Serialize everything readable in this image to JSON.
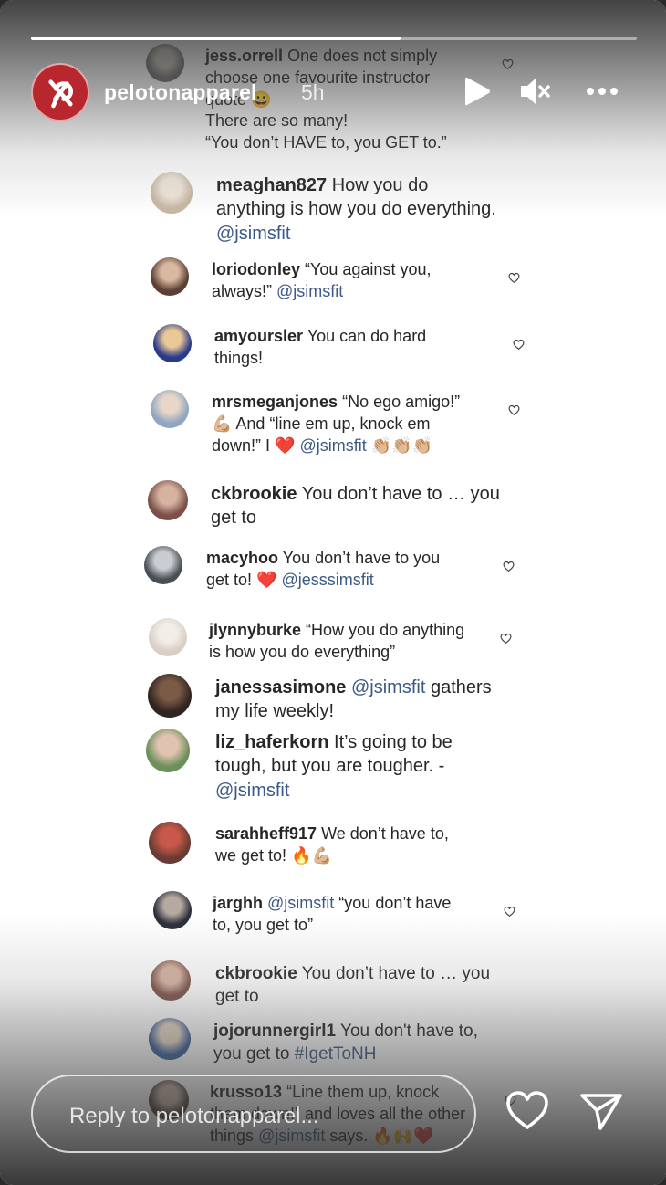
{
  "story": {
    "username": "pelotonapparel",
    "time_ago": "5h",
    "progress": 0.61,
    "reply_placeholder": "Reply to pelotonapparel..."
  },
  "comments": [
    {
      "user": "jess.orrell",
      "lines": [
        "One does not simply",
        "choose one favourite instructor",
        "quote 😀",
        "There are so many!",
        "“You don’t HAVE to, you GET to.”"
      ]
    },
    {
      "user": "meaghan827",
      "lines": [
        "How you do",
        "anything is how you do everything."
      ],
      "mention": "@jsimsfit"
    },
    {
      "user": "loriodonley",
      "lines": [
        "“You against you,",
        "always!”"
      ],
      "mention": "@jsimsfit"
    },
    {
      "user": "amyoursler",
      "lines": [
        "You can do hard",
        "things!"
      ]
    },
    {
      "user": "mrsmeganjones",
      "lines": [
        "“No ego amigo!”",
        "💪🏼 And “line em up, knock em",
        "down!” I ❤️"
      ],
      "mention": "@jsimsfit",
      "suffix": " 👏🏼👏🏼👏🏼"
    },
    {
      "user": "ckbrookie",
      "lines": [
        "You don’t have to … you",
        "get to"
      ]
    },
    {
      "user": "macyhoo",
      "lines": [
        "You don’t have to you",
        "get to! ❤️"
      ],
      "mention": "@jesssimsfit"
    },
    {
      "user": "jlynnyburke",
      "lines": [
        "“How you do anything",
        "is how you do everything”"
      ]
    },
    {
      "user": "janessasimone",
      "lines": [
        "",
        "my life weekly!"
      ],
      "mention_first": "@jsimsfit",
      "first_tail": " gathers"
    },
    {
      "user": "liz_haferkorn",
      "lines": [
        "It’s going to be",
        "tough, but you are tougher. -"
      ],
      "mention": "@jsimsfit"
    },
    {
      "user": "sarahheff917",
      "lines": [
        "We don’t have to,",
        "we get to! 🔥💪🏼"
      ]
    },
    {
      "user": "jarghh",
      "lines": [
        "",
        "to, you get to”"
      ],
      "mention_first": "@jsimsfit",
      "first_tail": " “you don’t have"
    },
    {
      "user": "ckbrookie",
      "lines": [
        "You don’t have to … you",
        "get to"
      ]
    },
    {
      "user": "jojorunnergirl1",
      "lines": [
        "You don't have to,",
        "you get to"
      ],
      "mention_inline": "#IgetToNH"
    },
    {
      "user": "krusso13",
      "lines": [
        "“Line them up, knock",
        "them down!” and loves all the other",
        "things"
      ],
      "mention_inline": "@jsimsfit",
      "suffix": " says. 🔥🙌❤️"
    }
  ],
  "icons": {
    "avatar_logo": "peloton-logo",
    "play": "play-icon",
    "mute": "mute-icon",
    "more": "more-icon",
    "like": "heart-icon",
    "share": "send-icon",
    "comment_like": "heart-icon"
  },
  "colors": {
    "brand_red": "#b8262e",
    "mention_blue": "#3b5a87"
  }
}
